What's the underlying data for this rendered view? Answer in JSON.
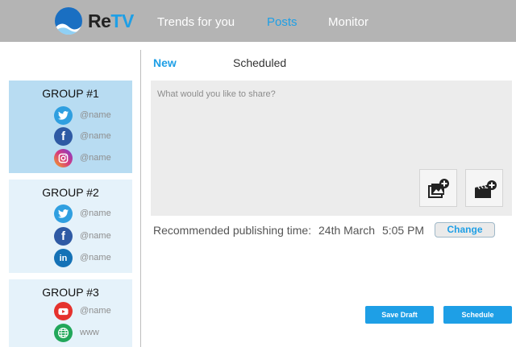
{
  "logo": {
    "text_main": "Re",
    "text_accent": "TV"
  },
  "nav": {
    "items": [
      {
        "label": "Trends for you",
        "active": false
      },
      {
        "label": "Posts",
        "active": true
      },
      {
        "label": "Monitor",
        "active": false
      }
    ]
  },
  "sidebar": {
    "groups": [
      {
        "title": "GROUP #1",
        "selected": true,
        "accounts": [
          {
            "icon": "twitter-icon",
            "handle": "@name",
            "color": "#2f9fe0"
          },
          {
            "icon": "facebook-icon",
            "handle": "@name",
            "color": "#2f5aa4"
          },
          {
            "icon": "instagram-icon",
            "handle": "@name",
            "color": "#d63a7c"
          }
        ]
      },
      {
        "title": "GROUP #2",
        "selected": false,
        "accounts": [
          {
            "icon": "twitter-icon",
            "handle": "@name",
            "color": "#2f9fe0"
          },
          {
            "icon": "facebook-icon",
            "handle": "@name",
            "color": "#2f5aa4"
          },
          {
            "icon": "linkedin-icon",
            "handle": "@name",
            "color": "#1572b6"
          }
        ]
      },
      {
        "title": "GROUP #3",
        "selected": false,
        "accounts": [
          {
            "icon": "youtube-icon",
            "handle": "@name",
            "color": "#e5322d"
          },
          {
            "icon": "globe-icon",
            "handle": "www",
            "color": "#22a75a"
          }
        ]
      }
    ]
  },
  "tabs": {
    "new": "New",
    "scheduled": "Scheduled"
  },
  "composer": {
    "placeholder": "What would you like to share?"
  },
  "recommendation": {
    "label": "Recommended publishing time:",
    "date": "24th March",
    "time": "5:05 PM",
    "change_label": "Change"
  },
  "actions": {
    "save_draft": "Save Draft",
    "schedule": "Schedule"
  },
  "colors": {
    "accent": "#1e9fe6",
    "topbar": "#b4b4b4",
    "selected_group": "#b8dcf2",
    "group": "#e5f2fa"
  }
}
